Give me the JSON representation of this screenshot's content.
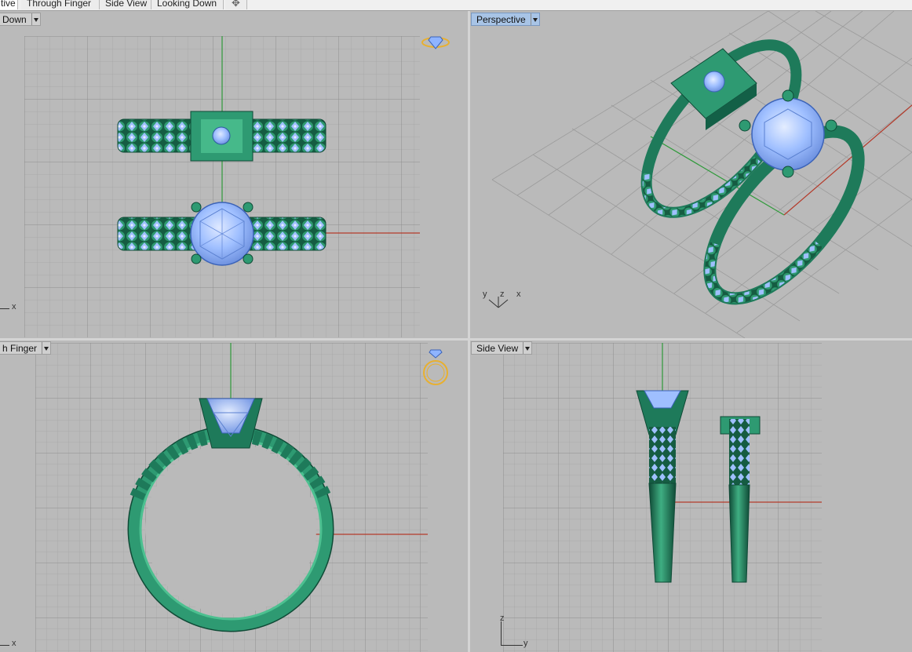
{
  "tabs": [
    {
      "label": "Perspective",
      "visible": "tive",
      "active": true
    },
    {
      "label": "Through Finger",
      "active": false
    },
    {
      "label": "Side View",
      "active": false
    },
    {
      "label": "Looking Down",
      "active": false
    }
  ],
  "add_tab_glyph": "✥",
  "viewports": {
    "top_left": {
      "label": "Looking Down",
      "visible": "Down",
      "active": false,
      "axis_x": "x"
    },
    "top_right": {
      "label": "Perspective",
      "active": true,
      "axis_y": "y",
      "axis_z": "z",
      "axis_x": "x"
    },
    "bottom_left": {
      "label": "Through Finger",
      "visible": "h Finger",
      "active": false,
      "axis_x": "x"
    },
    "bottom_right": {
      "label": "Side View",
      "active": false,
      "axis_z": "z",
      "axis_y": "y"
    }
  },
  "colors": {
    "viewport_bg": "#bababa",
    "grid_minor": "#a9a9a9",
    "grid_major": "#8e8e8e",
    "metal": "#1e7a5a",
    "metal_light": "#3fae82",
    "metal_dark": "#0f4a36",
    "gem": "#8fb4ff",
    "gem_light": "#c9dcff",
    "axis_red": "#b43a2a",
    "axis_green": "#2f9a3a",
    "active_label": "#a8c4e6",
    "widget_gold": "#e8b030"
  },
  "icons": {
    "view_widget_top": "ring-view-widget-icon",
    "view_widget_front": "ring-front-widget-icon"
  }
}
